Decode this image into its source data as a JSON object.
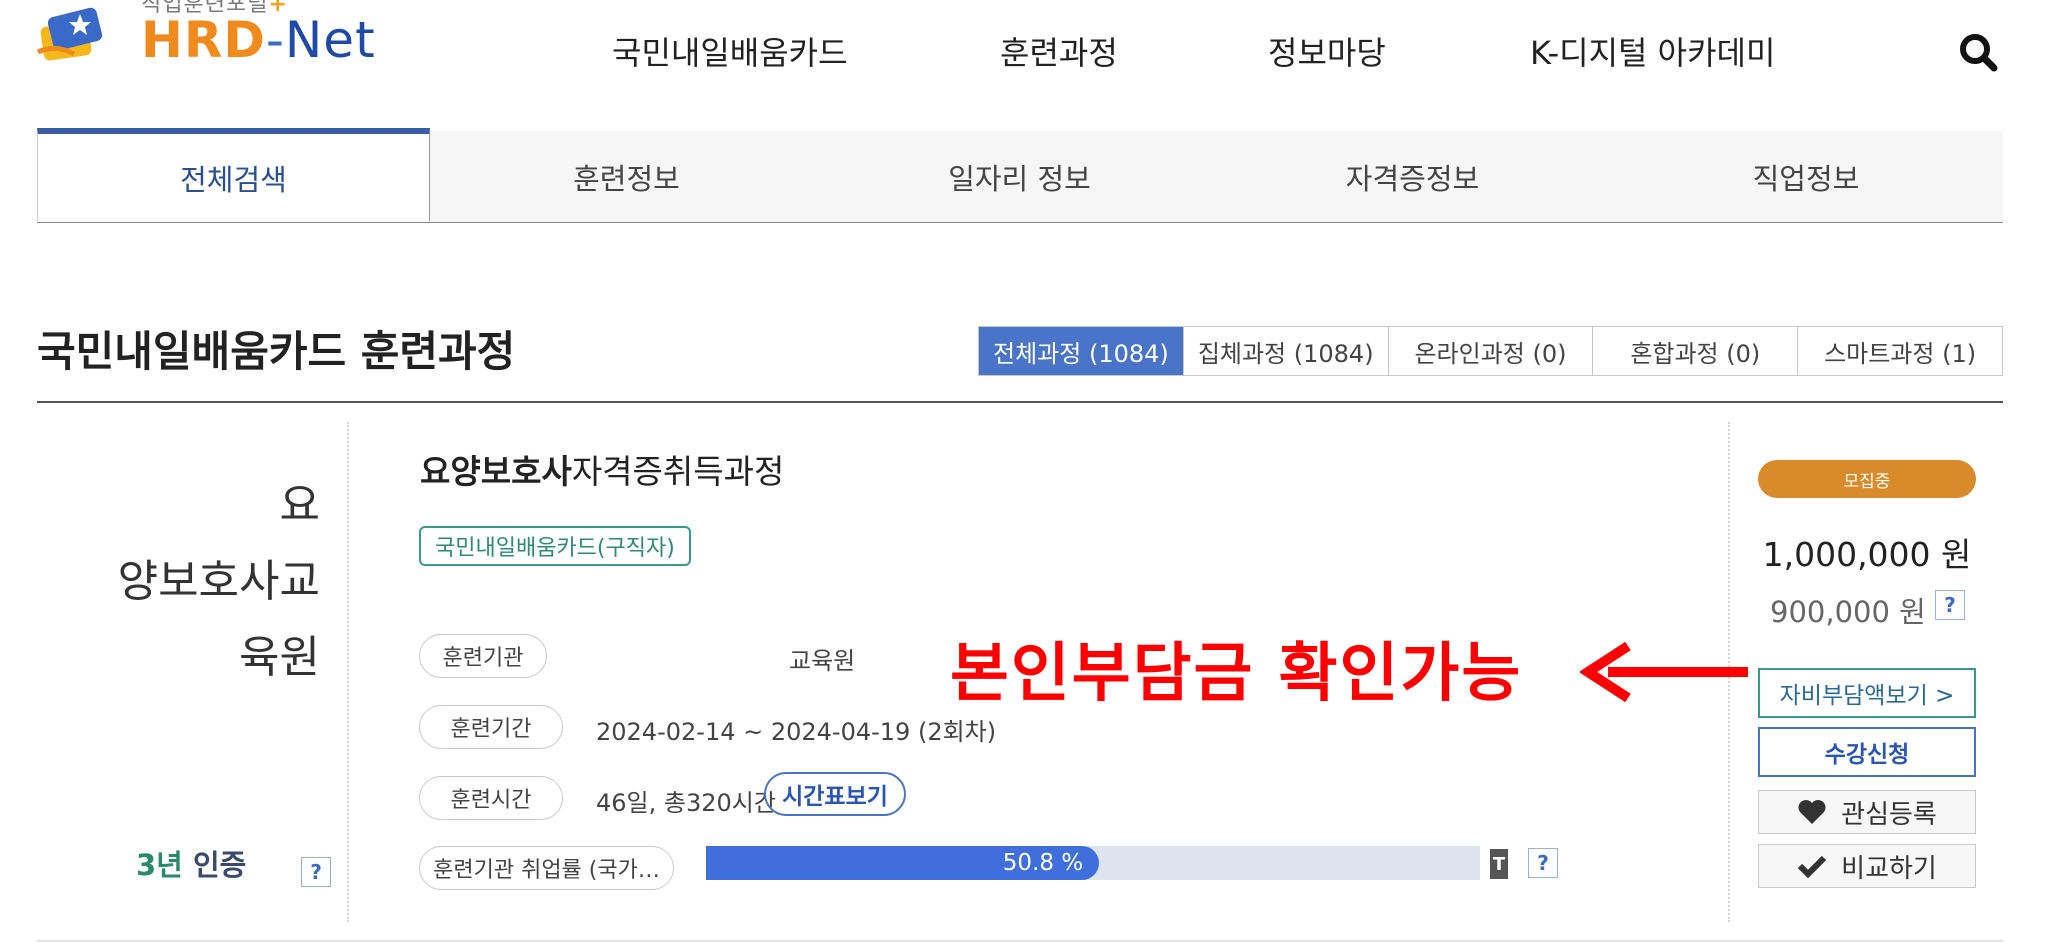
{
  "header": {
    "logo_sub": "직업훈련포털",
    "logo_hrd": "HRD",
    "logo_dash": "-",
    "logo_net": "Net",
    "nav": [
      "국민내일배움카드",
      "훈련과정",
      "정보마당",
      "K-디지털 아카데미"
    ],
    "search_icon": "search-icon"
  },
  "search_tabs": [
    "전체검색",
    "훈련정보",
    "일자리 정보",
    "자격증정보",
    "직업정보"
  ],
  "section": {
    "title": "국민내일배움카드 훈련과정",
    "filters": [
      "전체과정 (1084)",
      "집체과정 (1084)",
      "온라인과정 (0)",
      "혼합과정 (0)",
      "스마트과정 (1)"
    ]
  },
  "course": {
    "org_lines": [
      "요",
      "양보호사교",
      "육원"
    ],
    "certification_num": "3년",
    "certification_label": "인증",
    "help": "?",
    "title_bold": "요양보호사",
    "title_rest": "자격증취득과정",
    "card_type": "국민내일배움카드(구직자)",
    "labels": {
      "institution": "훈련기관",
      "period": "훈련기간",
      "hours": "훈련시간",
      "employment": "훈련기관 취업률 (국가…"
    },
    "institution_value": "교육원",
    "period_value": "2024-02-14 ~ 2024-04-19 (2회차)",
    "hours_value": "46일, 총320시간",
    "timetable_button": "시간표보기",
    "employment_rate": 50.8,
    "employment_rate_label": "50.8 %",
    "mini_tag": "T"
  },
  "annotation": {
    "text": "본인부담금 확인가능",
    "color": "#ff0000"
  },
  "side": {
    "status": "모집중",
    "price_full": "1,000,000 원",
    "price_support": "900,000 원",
    "self_pay_button": "자비부담액보기 >",
    "apply_button": "수강신청",
    "interest_button": "관심등록",
    "compare_button": "비교하기"
  },
  "colors": {
    "brand_orange": "#f08a1c",
    "brand_blue": "#1f4aa8",
    "active_filter": "#4a74c8",
    "status_badge": "#d98a2a",
    "progress": "#3f6fdc"
  }
}
